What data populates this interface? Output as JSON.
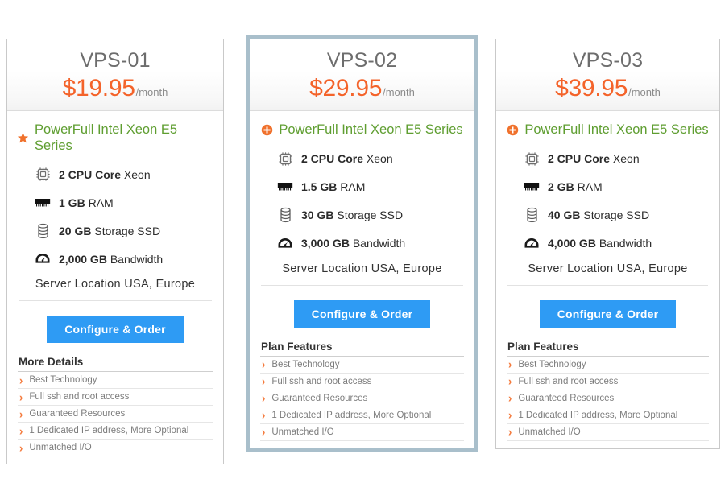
{
  "colors": {
    "price_orange": "#f4632a",
    "series_green": "#5f9e31",
    "cta_blue": "#2e9bf4",
    "chevron_orange": "#f4793b",
    "highlight_border": "#a9bfcb",
    "card_border": "#c9c9c9"
  },
  "plans": [
    {
      "name": "VPS-01",
      "price": "$19.95",
      "period": "/month",
      "highlighted": false,
      "series_icon": "star-icon",
      "series_label": "PowerFull Intel Xeon E5 Series",
      "specs": [
        {
          "icon": "cpu-chip-icon",
          "value": "2 CPU Core",
          "unit": "Xeon"
        },
        {
          "icon": "ram-stick-icon",
          "value": "1 GB",
          "unit": "RAM"
        },
        {
          "icon": "disk-storage-icon",
          "value": "20 GB",
          "unit": "Storage SSD"
        },
        {
          "icon": "speedometer-icon",
          "value": "2,000 GB",
          "unit": "Bandwidth"
        }
      ],
      "location": "Server Location USA, Europe",
      "cta_label": "Configure & Order",
      "features_title": "More Details",
      "features": [
        "Best Technology",
        "Full ssh and root access",
        "Guaranteed Resources",
        "1 Dedicated IP address, More Optional",
        "Unmatched I/O"
      ]
    },
    {
      "name": "VPS-02",
      "price": "$29.95",
      "period": "/month",
      "highlighted": true,
      "series_icon": "plus-circle-icon",
      "series_label": "PowerFull Intel Xeon E5 Series",
      "specs": [
        {
          "icon": "cpu-chip-icon",
          "value": "2 CPU Core",
          "unit": "Xeon"
        },
        {
          "icon": "ram-stick-icon",
          "value": "1.5 GB",
          "unit": "RAM"
        },
        {
          "icon": "disk-storage-icon",
          "value": "30 GB",
          "unit": "Storage SSD"
        },
        {
          "icon": "speedometer-icon",
          "value": "3,000 GB",
          "unit": "Bandwidth"
        }
      ],
      "location": "Server Location USA, Europe",
      "cta_label": "Configure & Order",
      "features_title": "Plan Features",
      "features": [
        "Best Technology",
        "Full ssh and root access",
        "Guaranteed Resources",
        "1 Dedicated IP address, More Optional",
        "Unmatched I/O"
      ]
    },
    {
      "name": "VPS-03",
      "price": "$39.95",
      "period": "/month",
      "highlighted": false,
      "series_icon": "plus-circle-icon",
      "series_label": "PowerFull Intel Xeon E5 Series",
      "specs": [
        {
          "icon": "cpu-chip-icon",
          "value": "2 CPU Core",
          "unit": "Xeon"
        },
        {
          "icon": "ram-stick-icon",
          "value": "2 GB",
          "unit": "RAM"
        },
        {
          "icon": "disk-storage-icon",
          "value": "40 GB",
          "unit": "Storage SSD"
        },
        {
          "icon": "speedometer-icon",
          "value": "4,000 GB",
          "unit": "Bandwidth"
        }
      ],
      "location": "Server Location USA, Europe",
      "cta_label": "Configure & Order",
      "features_title": "Plan Features",
      "features": [
        "Best Technology",
        "Full ssh and root access",
        "Guaranteed Resources",
        "1 Dedicated IP address, More Optional",
        "Unmatched I/O"
      ]
    }
  ]
}
